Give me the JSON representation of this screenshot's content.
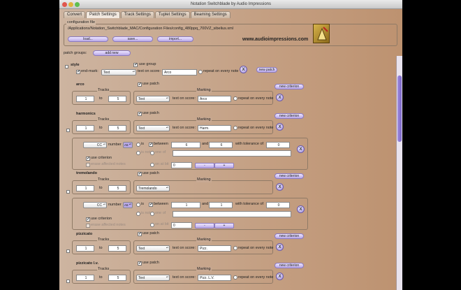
{
  "window": {
    "title": "Notation Switchblade by Audio Impressions"
  },
  "tabs": [
    "Convert",
    "Patch Settings",
    "Track Settings",
    "Tuplet Settings",
    "Beaming Settings"
  ],
  "config": {
    "heading": "configuration file",
    "path": "/Applications/Notation_Switchblade_MAC/Configuration Files/config_480ppq_700VZ_sibelius.xml",
    "load": "load...",
    "save": "save...",
    "import": "import...",
    "website": "www.audioimpressions.com"
  },
  "patch_groups": {
    "label": "patch groups:",
    "add": "add new"
  },
  "style": {
    "name": "style",
    "use_group": "use group",
    "end_mark": "end-mark:",
    "end_mark_value": "Text",
    "text_on_score": "text on score:",
    "text_value": "Arco",
    "repeat": "repeat on every note",
    "new_patch": "new patch"
  },
  "common": {
    "tracks": "Tracks",
    "to": "to",
    "use_patch": "use patch",
    "marking": "Marking",
    "text_on_score": "text on score:",
    "repeat": "repeat on every note",
    "new_criterion": "new criterion",
    "x": "X",
    "number": "number",
    "is": "is",
    "between": "between",
    "and": "and",
    "tolerance": "with tolerance of",
    "is_not": "is not",
    "one_of": "one of",
    "on_at_bit": "on at bit",
    "use_criterion": "use criterion",
    "erase": "erase affected notes",
    "cc": "CC",
    "a5": "A5",
    "minus": "-",
    "plus": "+"
  },
  "patches": [
    {
      "name": "arco",
      "from": "1",
      "to": "5",
      "type": "Text",
      "score_text": "Arco"
    },
    {
      "name": "harmonics",
      "from": "1",
      "to": "5",
      "type": "Text",
      "score_text": "Harm.",
      "crit": {
        "lo": "6",
        "hi": "6",
        "tol": "0",
        "bit": "0"
      }
    },
    {
      "name": "tremolando",
      "from": "1",
      "to": "5",
      "type": "Tremolando",
      "crit": {
        "lo": "1",
        "hi": "1",
        "tol": "0",
        "bit": "0"
      }
    },
    {
      "name": "pizzicato",
      "from": "1",
      "to": "5",
      "type": "Text",
      "score_text": "Pizz."
    },
    {
      "name": "pizzicato l.v.",
      "from": "1",
      "to": "5",
      "type": "Text",
      "score_text": "Pizz. L.V."
    }
  ],
  "colors": {
    "accent": "#9c89da",
    "background": "#c9ab93"
  }
}
